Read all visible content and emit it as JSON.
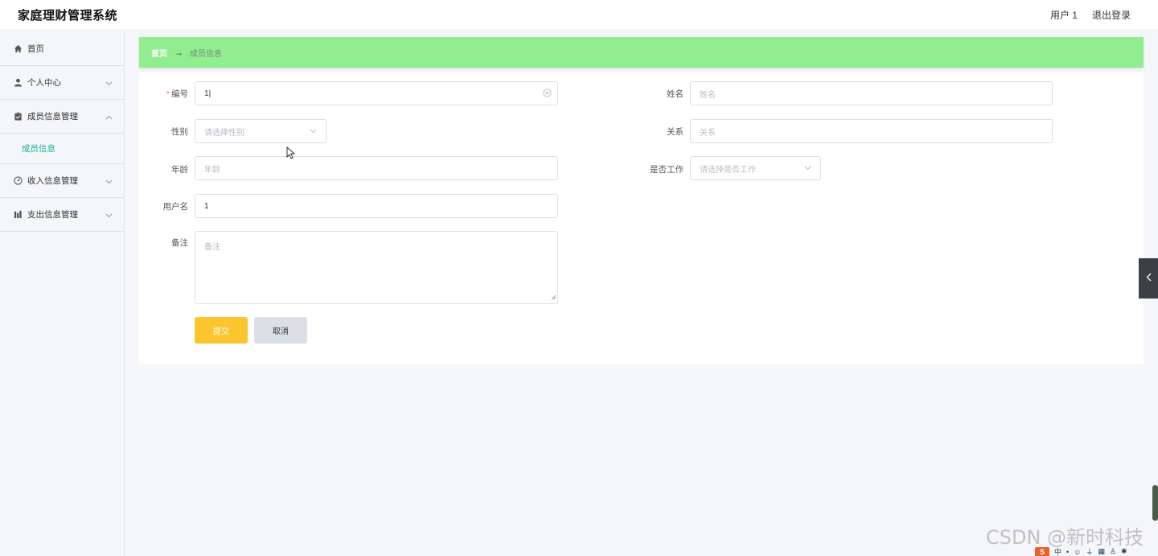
{
  "header": {
    "title": "家庭理财管理系统",
    "user": "用户 1",
    "logout": "退出登录"
  },
  "sidebar": {
    "items": [
      {
        "label": "首页",
        "icon": "home-icon"
      },
      {
        "label": "个人中心",
        "icon": "user-icon"
      },
      {
        "label": "成员信息管理",
        "icon": "clipboard-icon"
      },
      {
        "label": "收入信息管理",
        "icon": "gauge-icon"
      },
      {
        "label": "支出信息管理",
        "icon": "bar-chart-icon"
      }
    ],
    "active_submenu": "成员信息"
  },
  "breadcrumb": {
    "home": "首页",
    "separator": "→",
    "current": "成员信息"
  },
  "form": {
    "id_label": "编号",
    "id_value": "1",
    "name_label": "姓名",
    "name_placeholder": "姓名",
    "gender_label": "性别",
    "gender_placeholder": "请选择性别",
    "relation_label": "关系",
    "relation_placeholder": "关系",
    "age_label": "年龄",
    "age_placeholder": "年龄",
    "working_label": "是否工作",
    "working_placeholder": "请选择是否工作",
    "username_label": "用户名",
    "username_value": "1",
    "remark_label": "备注",
    "remark_placeholder": "备注",
    "submit": "提交",
    "cancel": "取消"
  },
  "watermark": "CSDN @新时科技",
  "tray": {
    "s": "S",
    "zh": "中"
  },
  "colors": {
    "breadcrumb_bg": "#90ee90",
    "active_menu": "#1ab394",
    "submit_bg": "#fbc530",
    "cancel_bg": "#dcdfe6",
    "required": "#f56c6c"
  }
}
